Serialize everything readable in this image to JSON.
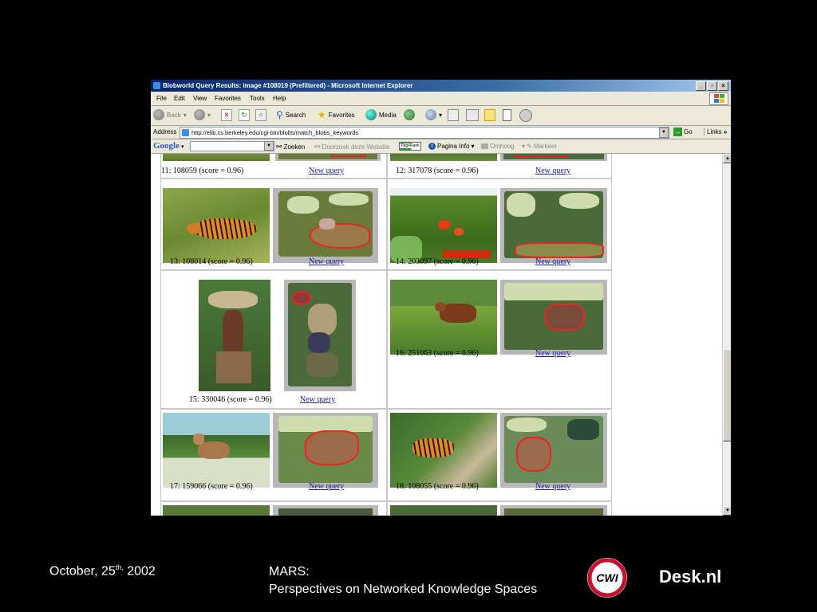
{
  "window": {
    "title": "Blobworld Query Results: image #108019 (Prefiltered) - Microsoft Internet Explorer"
  },
  "menu": [
    "File",
    "Edit",
    "View",
    "Favorites",
    "Tools",
    "Help"
  ],
  "toolbar": {
    "back": "Back",
    "search": "Search",
    "favorites": "Favorites",
    "media": "Media"
  },
  "address": {
    "label": "Address",
    "url": "http://elib.cs.berkeley.edu/cgi-bin/blobs/match_blobs_keywords",
    "go": "Go",
    "links": "Links"
  },
  "google_bar": {
    "logo": "Google",
    "search_value": "",
    "zoeken": "Zoeken",
    "doorzoek": "Doorzoek deze Website",
    "pagerank": "PageRank",
    "pagina_info": "Pagina Info",
    "omhoog": "Omhoog",
    "markeer": "Markeer"
  },
  "results": {
    "top_row": [
      {
        "caption": "11: 108059 (score = 0.96)",
        "link": "New query"
      },
      {
        "caption": "12: 317078 (score = 0.96)",
        "link": "New query"
      }
    ],
    "items": [
      {
        "caption": "13: 108014 (score = 0.96)",
        "link": "New query"
      },
      {
        "caption": "14: 203097 (score = 0.96)",
        "link": "New query"
      },
      {
        "caption": "15: 330046 (score = 0.96)",
        "link": "New query"
      },
      {
        "caption": "16: 251063 (score = 0.96)",
        "link": "New query"
      },
      {
        "caption": "17: 159066 (score = 0.96)",
        "link": "New query"
      },
      {
        "caption": "18: 108055 (score = 0.96)",
        "link": "New query"
      }
    ]
  },
  "slide": {
    "date_prefix": "October, 25",
    "date_sup": "th,",
    "date_year": " 2002",
    "title_line1": "MARS:",
    "title_line2": "Perspectives on Networked Knowledge Spaces",
    "logo_left": "CWI",
    "logo_right": "Desk.nl"
  }
}
